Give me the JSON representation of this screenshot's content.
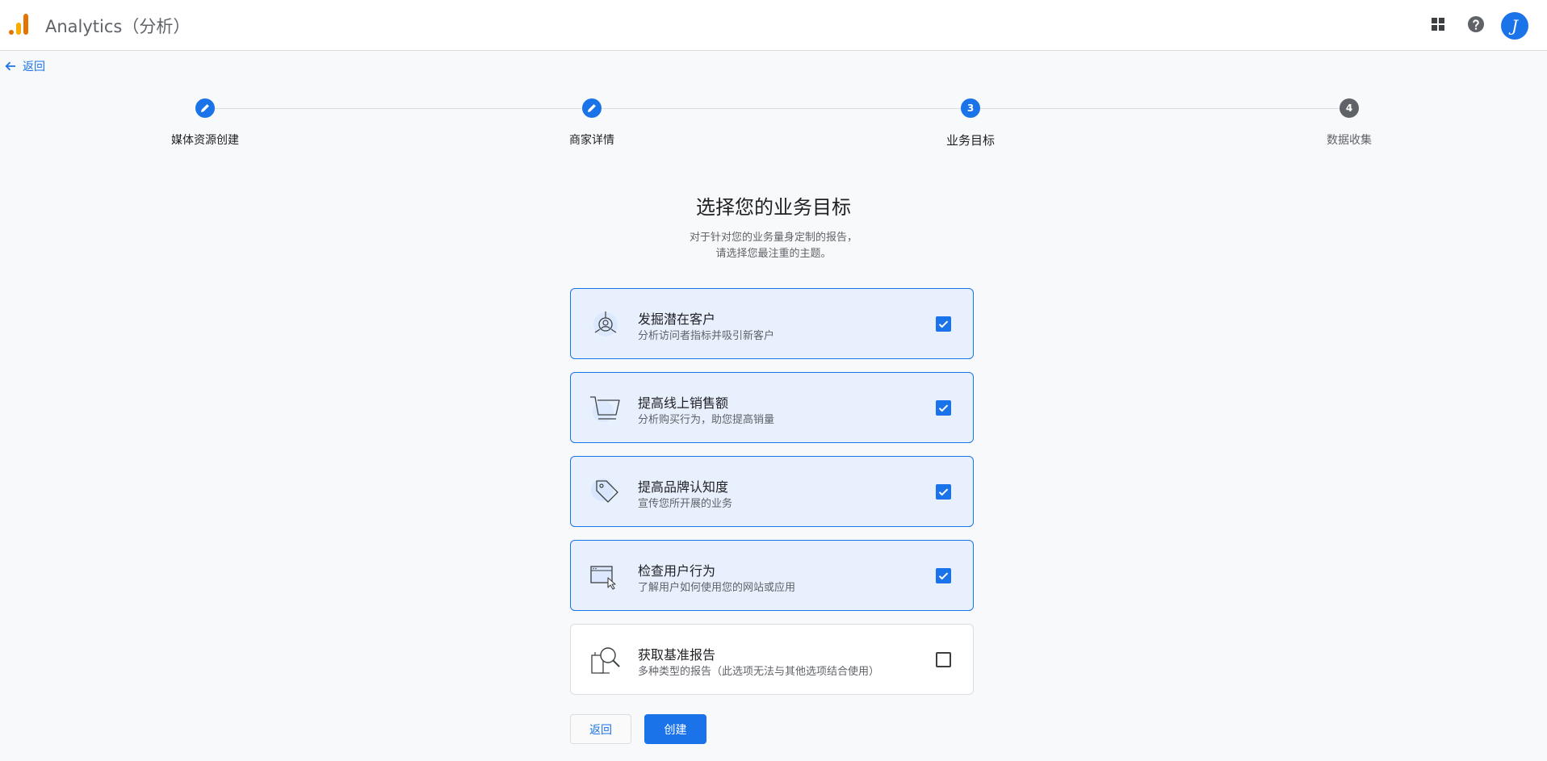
{
  "header": {
    "app_title": "Analytics（分析）",
    "avatar_letter": "J",
    "accent_color": "#1a73e8"
  },
  "nav": {
    "back_label": "返回"
  },
  "stepper": {
    "steps": [
      {
        "label": "媒体资源创建",
        "state": "completed"
      },
      {
        "label": "商家详情",
        "state": "completed"
      },
      {
        "label": "业务目标",
        "number": "3",
        "state": "current"
      },
      {
        "label": "数据收集",
        "number": "4",
        "state": "pending"
      }
    ]
  },
  "main": {
    "title": "选择您的业务目标",
    "subtitle_line1": "对于针对您的业务量身定制的报告，",
    "subtitle_line2": "请选择您最注重的主题。",
    "options": [
      {
        "title": "发掘潜在客户",
        "description": "分析访问者指标并吸引新客户",
        "checked": true,
        "icon": "target-user-icon"
      },
      {
        "title": "提高线上销售额",
        "description": "分析购买行为，助您提高销量",
        "checked": true,
        "icon": "shopping-cart-icon"
      },
      {
        "title": "提高品牌认知度",
        "description": "宣传您所开展的业务",
        "checked": true,
        "icon": "price-tag-icon"
      },
      {
        "title": "检查用户行为",
        "description": "了解用户如何使用您的网站或应用",
        "checked": true,
        "icon": "browser-cursor-icon"
      },
      {
        "title": "获取基准报告",
        "description": "多种类型的报告（此选项无法与其他选项结合使用）",
        "checked": false,
        "icon": "magnifier-report-icon"
      }
    ]
  },
  "footer": {
    "back_button": "返回",
    "create_button": "创建"
  }
}
